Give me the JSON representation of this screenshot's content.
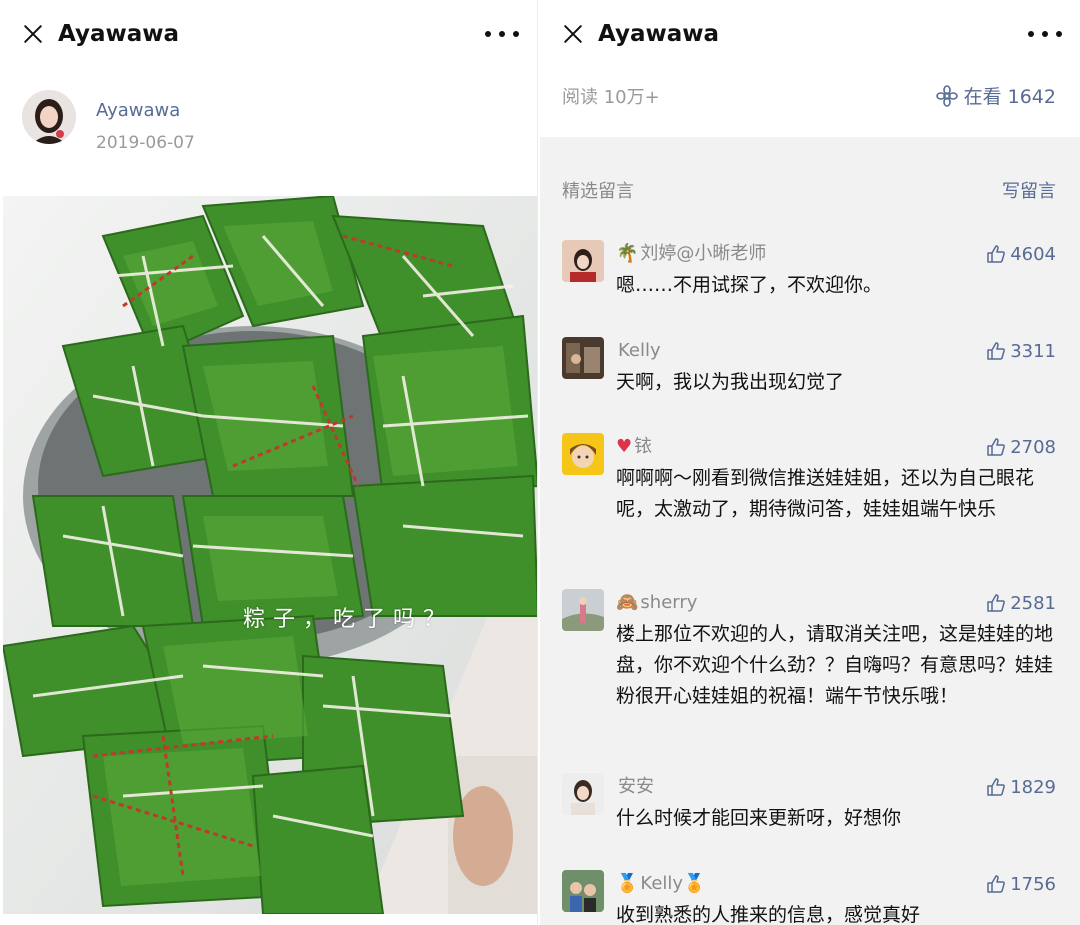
{
  "left": {
    "title": "Ayawawa",
    "author": {
      "name": "Ayawawa",
      "date": "2019-06-07"
    },
    "photo_caption": "粽子，吃了吗？"
  },
  "right": {
    "title": "Ayawawa",
    "reads": "阅读 10万+",
    "looking": "在看 1642",
    "comments_title": "精选留言",
    "write_label": "写留言",
    "comments": [
      {
        "deco": "🌴",
        "name": "刘婷@小晰老师",
        "likes": "4604",
        "text": "嗯……不用试探了，不欢迎你。"
      },
      {
        "deco": "",
        "name": "Kelly",
        "likes": "3311",
        "text": "天啊，我以为我出现幻觉了"
      },
      {
        "deco": "♥",
        "name": "铱",
        "likes": "2708",
        "text": "啊啊啊～刚看到微信推送娃娃姐，还以为自己眼花呢，太激动了，期待微问答，娃娃姐端午快乐"
      },
      {
        "deco": "🙈",
        "name": "sherry",
        "likes": "2581",
        "text": "楼上那位不欢迎的人，请取消关注吧，这是娃娃的地盘，你不欢迎个什么劲？？自嗨吗？有意思吗？娃娃粉很开心娃娃姐的祝福！端午节快乐哦！"
      },
      {
        "deco": "",
        "name": "安安",
        "likes": "1829",
        "text": "什么时候才能回来更新呀，好想你"
      },
      {
        "deco": "🏅",
        "name": "Kelly🏅",
        "likes": "1756",
        "text": "收到熟悉的人推来的信息，感觉真好"
      }
    ]
  },
  "colors": {
    "link": "#576b95",
    "muted": "#9a9a9a",
    "comment_bg": "#f2f2f2",
    "leaf_green": "#3f8f2a"
  },
  "icons": {
    "close": "close-icon",
    "more": "more-dots-icon",
    "like": "thumbs-up-icon",
    "looking": "flower-icon"
  }
}
